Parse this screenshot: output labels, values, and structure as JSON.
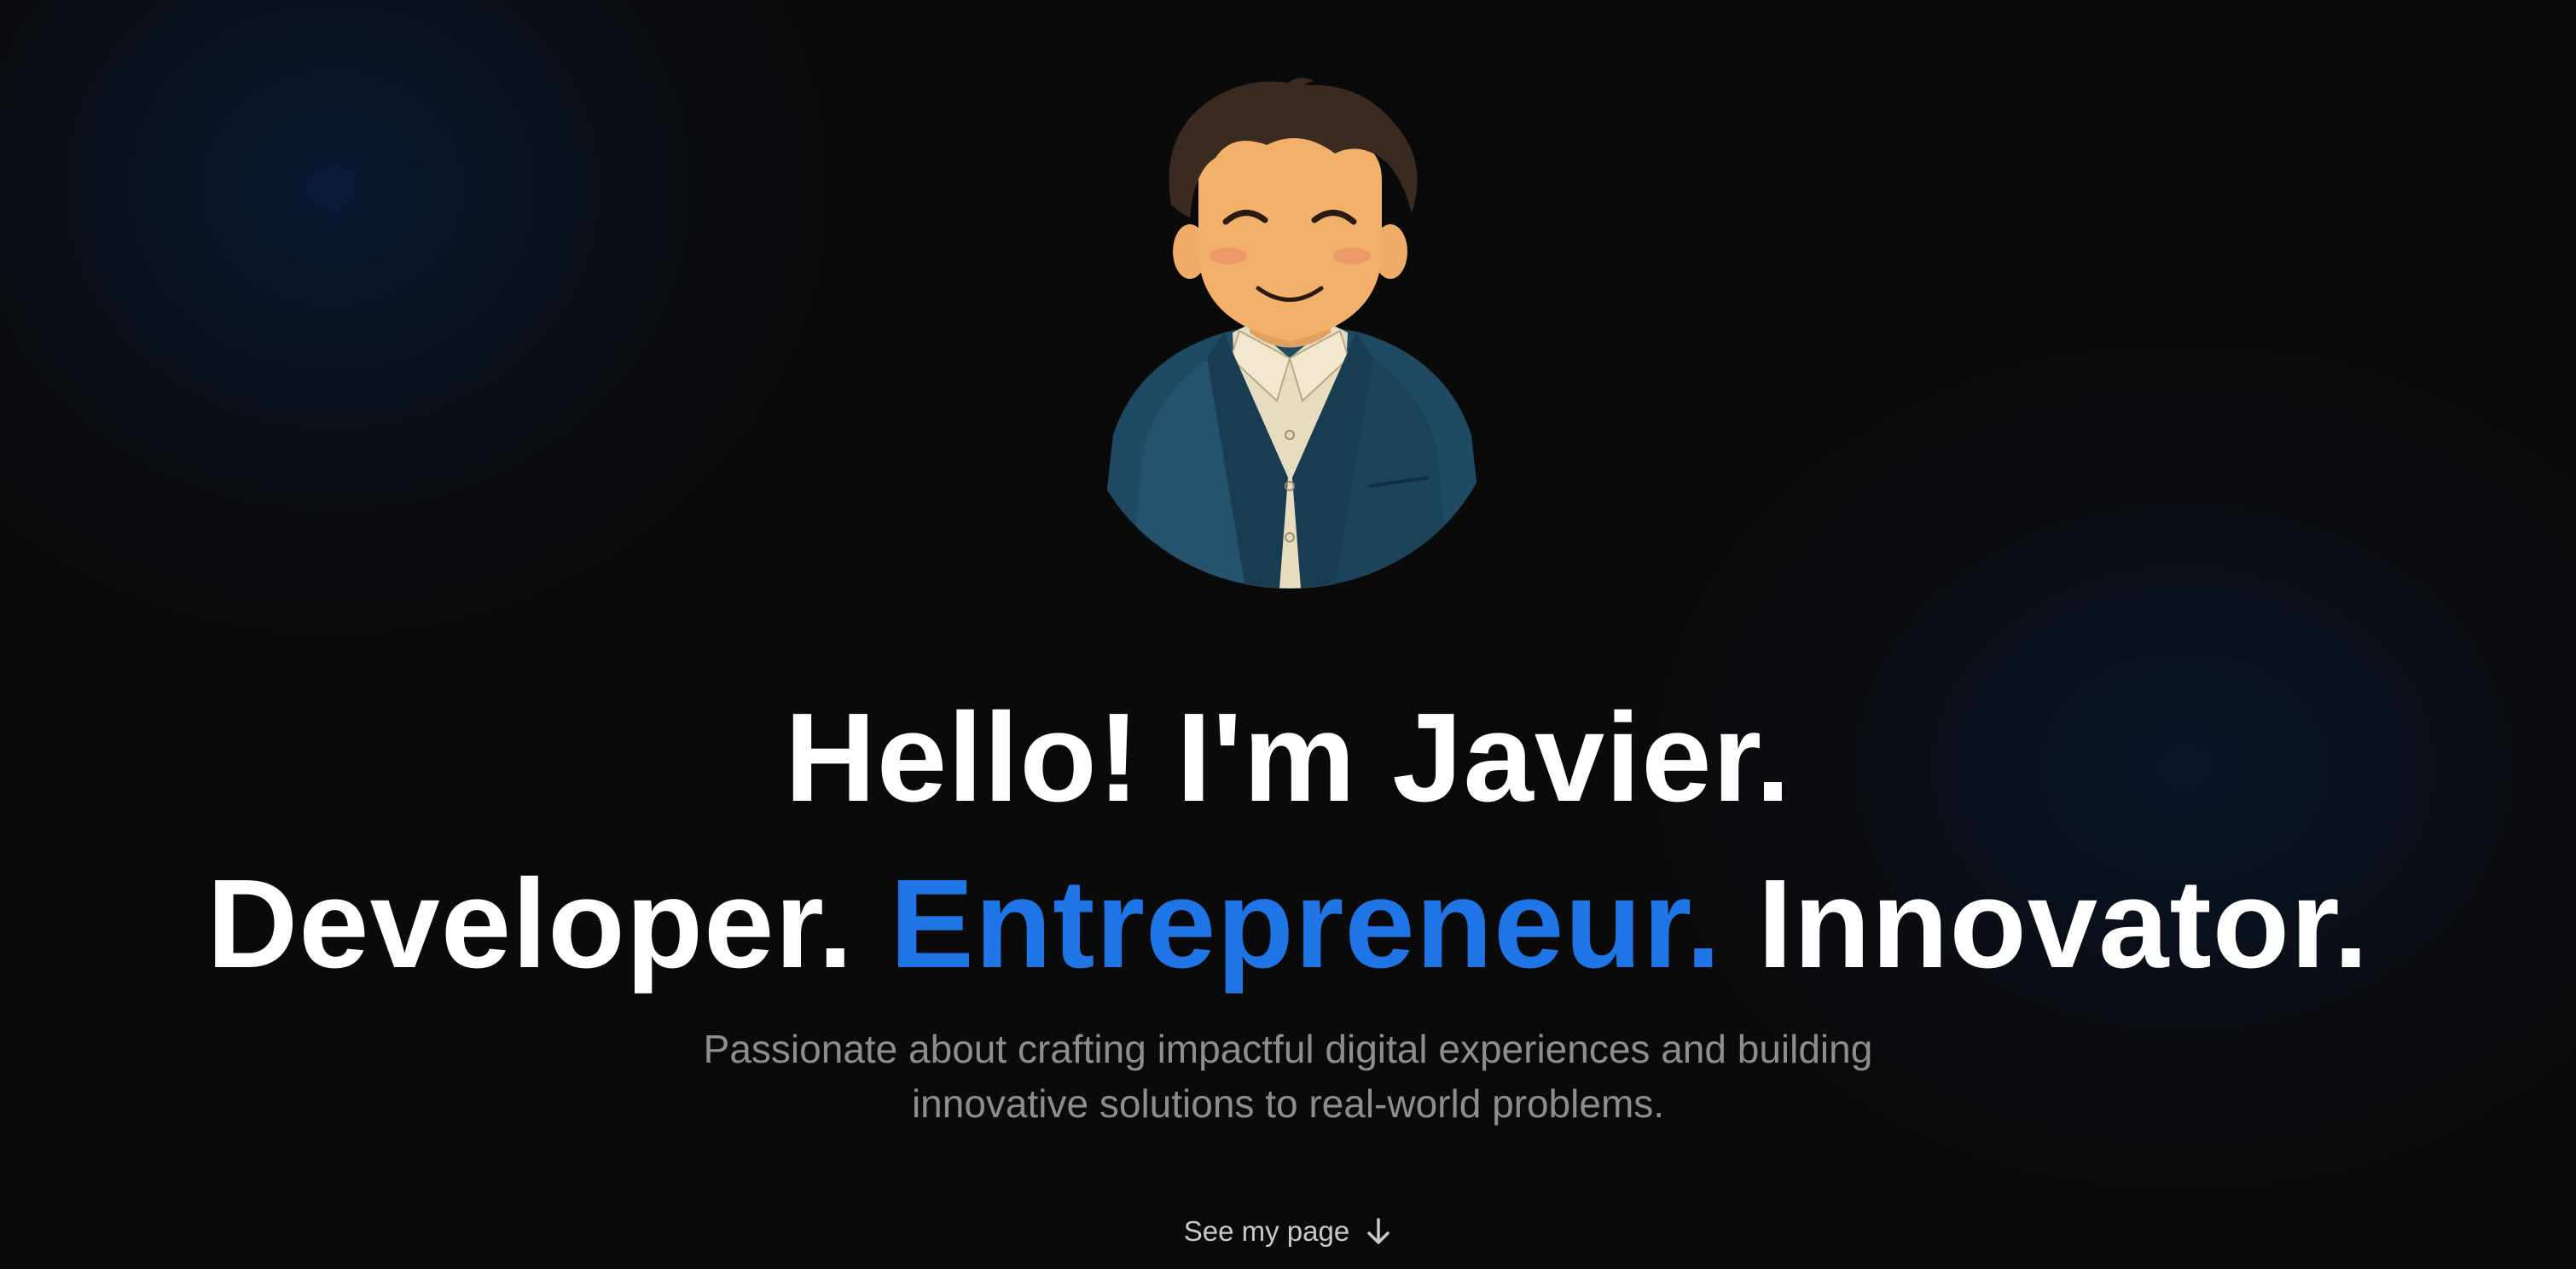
{
  "hero": {
    "avatar": {
      "icon": "avatar-illustration",
      "alt_colors": {
        "jacket": "#1f4a63",
        "shirt": "#e8dcc0",
        "skin": "#f2b06b",
        "hair": "#3b2a1f"
      }
    },
    "headline_line1": "Hello! I'm Javier.",
    "headline_line2": {
      "part1": "Developer.",
      "part2": "Entrepreneur.",
      "part3": "Innovator."
    },
    "subtitle_line1": "Passionate about crafting impactful digital experiences and building",
    "subtitle_line2": "innovative solutions to real-world problems.",
    "cta_label": "See my page",
    "cta_icon": "arrow-down-icon"
  },
  "colors": {
    "background": "#0a0a0a",
    "accent": "#1f74e6",
    "text_primary": "#ffffff",
    "text_muted": "#8d8d8d"
  }
}
